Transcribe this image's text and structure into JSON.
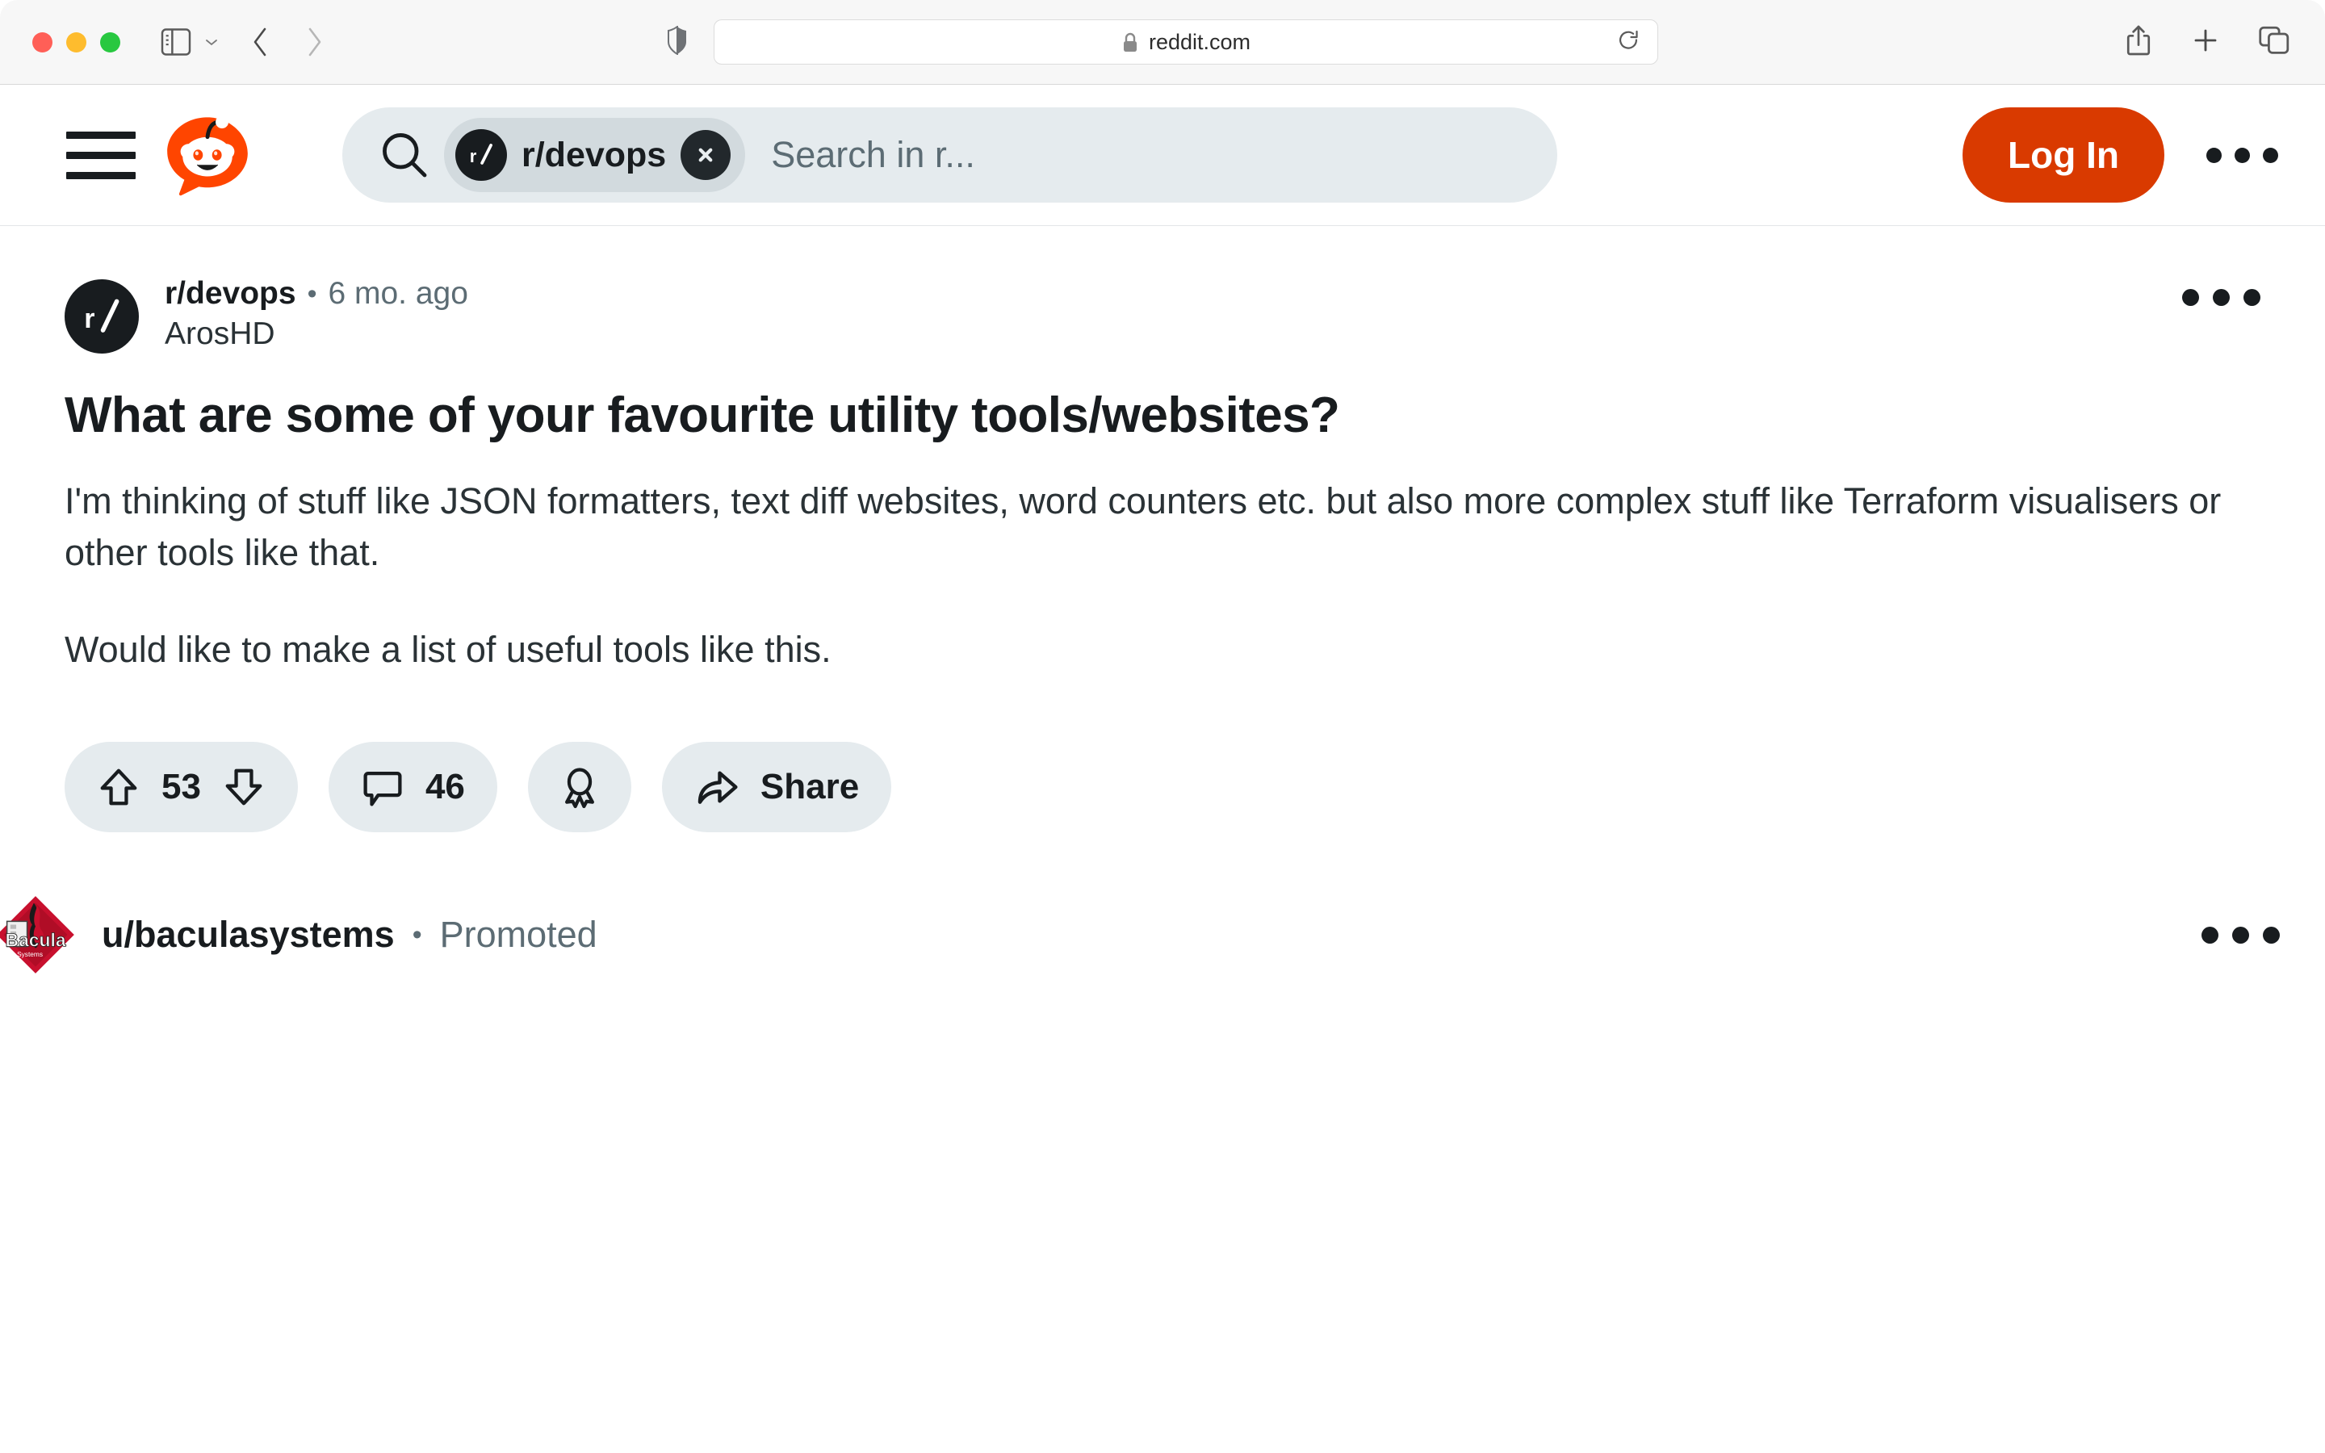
{
  "browser": {
    "url": "reddit.com",
    "lock_icon": "lock-icon",
    "shield_icon": "privacy-shield-icon",
    "reload_icon": "reload-icon",
    "sidebar_icon": "sidebar-toggle-icon",
    "back_icon": "back-chevron-icon",
    "forward_icon": "forward-chevron-icon",
    "share_icon": "share-icon",
    "new_tab_icon": "plus-icon",
    "tabs_icon": "tab-overview-icon"
  },
  "header": {
    "menu_icon": "hamburger-menu-icon",
    "logo_icon": "reddit-snoo-logo",
    "search": {
      "search_icon": "search-icon",
      "chip_label": "r/devops",
      "chip_avatar_icon": "subreddit-avatar-icon",
      "chip_close_icon": "close-icon",
      "placeholder": "Search in r..."
    },
    "login_label": "Log In",
    "overflow_icon": "more-options-icon"
  },
  "post": {
    "avatar_icon": "subreddit-avatar-icon",
    "subreddit": "r/devops",
    "separator": "•",
    "age": "6 mo. ago",
    "author": "ArosHD",
    "overflow_icon": "post-more-options-icon",
    "title": "What are some of your favourite utility tools/websites?",
    "body": [
      "I'm thinking of stuff like JSON formatters, text diff websites, word counters etc. but also more complex stuff like Terraform visualisers or other tools like that.",
      "Would like to make a list of useful tools like this."
    ],
    "actions": {
      "upvote_icon": "upvote-arrow-icon",
      "vote_count": "53",
      "downvote_icon": "downvote-arrow-icon",
      "comment_icon": "comment-bubble-icon",
      "comment_count": "46",
      "award_icon": "award-rosette-icon",
      "share_icon": "share-arrow-icon",
      "share_label": "Share"
    }
  },
  "promoted": {
    "logo_icon": "bacula-systems-logo",
    "username": "u/baculasystems",
    "separator": "•",
    "label": "Promoted",
    "overflow_icon": "promoted-more-options-icon"
  },
  "colors": {
    "brand_orange": "#d93a00",
    "search_bg": "#e5ebee",
    "chip_bg": "#d2dade",
    "text_primary": "#181c1f",
    "text_secondary": "#5c6c74"
  }
}
